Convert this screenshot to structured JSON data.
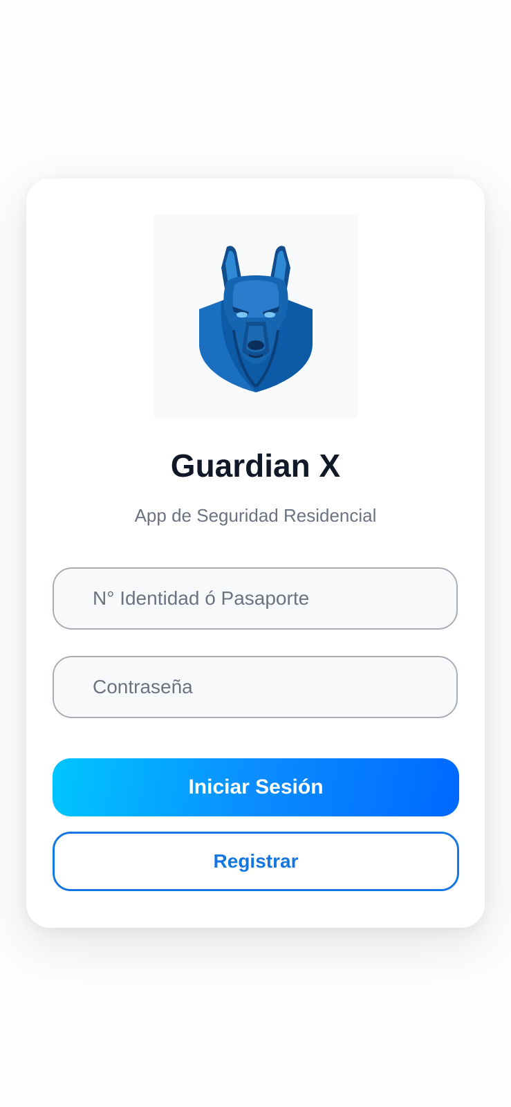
{
  "app": {
    "title": "Guardian X",
    "subtitle": "App de Seguridad Residencial",
    "logo_icon": "guard-dog-shield-icon"
  },
  "form": {
    "id_placeholder": "N° Identidad ó Pasaporte",
    "id_value": "",
    "password_placeholder": "Contraseña",
    "password_value": ""
  },
  "actions": {
    "login_label": "Iniciar Sesión",
    "register_label": "Registrar"
  },
  "colors": {
    "title": "#111827",
    "subtitle": "#6b7280",
    "login_gradient_start": "#00c6ff",
    "login_gradient_end": "#0068ff",
    "register_accent": "#1476e0",
    "logo_blue": "#1565b0"
  }
}
